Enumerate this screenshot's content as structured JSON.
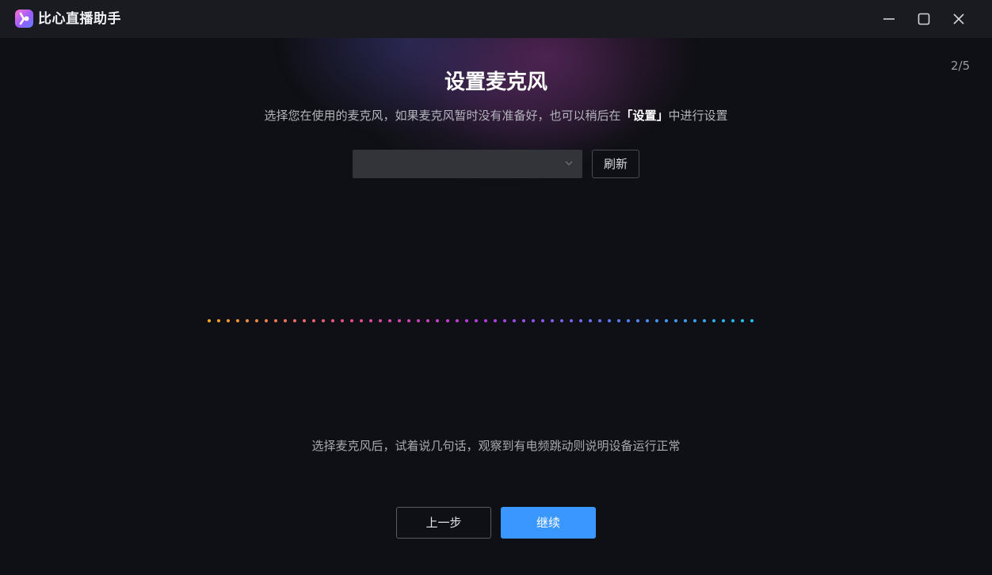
{
  "app": {
    "title": "比心直播助手",
    "logo_icon": "bixin-logo-icon"
  },
  "window_controls": {
    "minimize_icon": "minimize-icon",
    "maximize_icon": "maximize-icon",
    "close_icon": "close-icon"
  },
  "wizard": {
    "step": "2/5",
    "title": "设置麦克风",
    "subtitle_prefix": "选择您在使用的麦克风，如果麦克风暂时没有准备好，也可以稍后在",
    "subtitle_highlight": "「设置」",
    "subtitle_suffix": "中进行设置"
  },
  "mic_select": {
    "selected_value": "",
    "chevron_icon": "chevron-down-icon"
  },
  "refresh_label": "刷新",
  "level_meter": {
    "dot_count": 58,
    "gradient_colors": [
      "#f6a623",
      "#e84d8a",
      "#b53be0",
      "#5a7cff",
      "#1ec2f2"
    ]
  },
  "hint": "选择麦克风后，试着说几句话，观察到有电频跳动则说明设备运行正常",
  "footer": {
    "prev_label": "上一步",
    "next_label": "继续"
  },
  "colors": {
    "primary": "#3a97ff",
    "background": "#0f1015",
    "titlebar": "#1a1b21"
  }
}
